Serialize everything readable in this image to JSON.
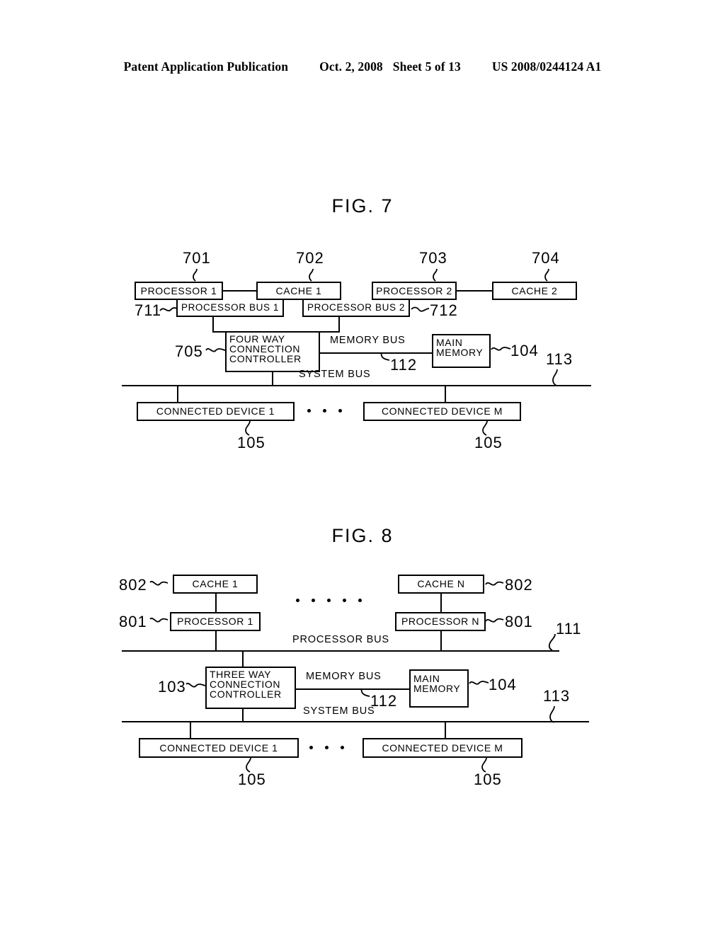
{
  "header": {
    "publication": "Patent Application Publication",
    "date": "Oct. 2, 2008",
    "sheet": "Sheet 5 of 13",
    "docnum": "US 2008/0244124 A1"
  },
  "fig7": {
    "title": "FIG. 7",
    "boxes": {
      "processor1": "PROCESSOR  1",
      "cache1": "CACHE  1",
      "processor2": "PROCESSOR 2",
      "cache2": "CACHE 2",
      "processor_bus1": "PROCESSOR BUS 1",
      "processor_bus2": "PROCESSOR BUS 2",
      "controller_l1": "FOUR WAY",
      "controller_l2": "CONNECTION",
      "controller_l3": "CONTROLLER",
      "main_memory_l1": "MAIN",
      "main_memory_l2": "MEMORY",
      "connected_device_1": "CONNECTED  DEVICE  1",
      "connected_device_m": "CONNECTED  DEVICE  M"
    },
    "labels": {
      "memory_bus": "MEMORY BUS",
      "system_bus": "SYSTEM  BUS"
    },
    "refs": {
      "r701": "701",
      "r702": "702",
      "r703": "703",
      "r704": "704",
      "r711": "711",
      "r712": "712",
      "r705": "705",
      "r112": "112",
      "r104": "104",
      "r113": "113",
      "r105a": "105",
      "r105b": "105"
    }
  },
  "fig8": {
    "title": "FIG. 8",
    "boxes": {
      "cache1": "CACHE  1",
      "cacheN": "CACHE  N",
      "processor1": "PROCESSOR 1",
      "processorN": "PROCESSOR N",
      "controller_l1": "THREE WAY",
      "controller_l2": "CONNECTION",
      "controller_l3": "CONTROLLER",
      "main_memory_l1": "MAIN",
      "main_memory_l2": "MEMORY",
      "connected_device_1": "CONNECTED  DEVICE  1",
      "connected_device_m": "CONNECTED  DEVICE  M"
    },
    "labels": {
      "processor_bus": "PROCESSOR  BUS",
      "memory_bus": "MEMORY  BUS",
      "system_bus": "SYSTEM  BUS"
    },
    "refs": {
      "r802a": "802",
      "r802b": "802",
      "r801a": "801",
      "r801b": "801",
      "r111": "111",
      "r103": "103",
      "r112": "112",
      "r104": "104",
      "r113": "113",
      "r105a": "105",
      "r105b": "105"
    }
  }
}
